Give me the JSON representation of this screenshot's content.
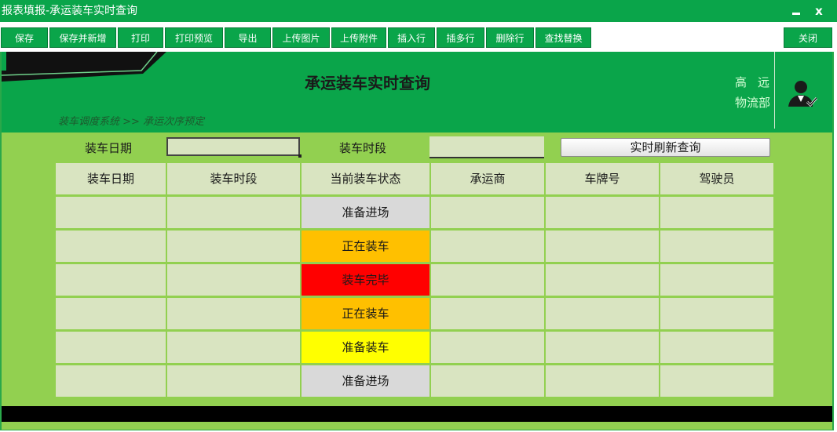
{
  "window": {
    "title": "报表填报-承运装车实时查询",
    "minimize_glyph": "",
    "close_glyph": "x"
  },
  "toolbar": {
    "buttons": [
      "保存",
      "保存并新增",
      "打印",
      "打印预览",
      "导出",
      "上传图片",
      "上传附件",
      "插入行",
      "插多行",
      "删除行",
      "查找替换"
    ],
    "close_label": "关闭"
  },
  "header": {
    "title": "承运装车实时查询",
    "breadcrumb": "装车调度系统 >> 承运次序预定",
    "user_name_line1": "高远",
    "user_name_line2": "物流部",
    "avatar_icon": "user-icon"
  },
  "filters": {
    "date_label": "装车日期",
    "date_value": "",
    "time_label": "装车时段",
    "time_value": "",
    "refresh_label": "实时刷新查询"
  },
  "table": {
    "columns": [
      "装车日期",
      "装车时段",
      "当前装车状态",
      "承运商",
      "车牌号",
      "驾驶员"
    ],
    "rows": [
      [
        "",
        "",
        "准备进场",
        "",
        "",
        ""
      ],
      [
        "",
        "",
        "正在装车",
        "",
        "",
        ""
      ],
      [
        "",
        "",
        "装车完毕",
        "",
        "",
        ""
      ],
      [
        "",
        "",
        "正在装车",
        "",
        "",
        ""
      ],
      [
        "",
        "",
        "准备装车",
        "",
        "",
        ""
      ],
      [
        "",
        "",
        "准备进场",
        "",
        "",
        ""
      ]
    ],
    "status_colors": {
      "准备进场": "#d9d9d9",
      "正在装车": "#ffc000",
      "装车完毕": "#ff0000",
      "准备装车": "#ffff00"
    }
  },
  "colors": {
    "brand_green": "#0aa54a",
    "light_green": "#92d050",
    "cell_bg": "#d9e4c1"
  }
}
